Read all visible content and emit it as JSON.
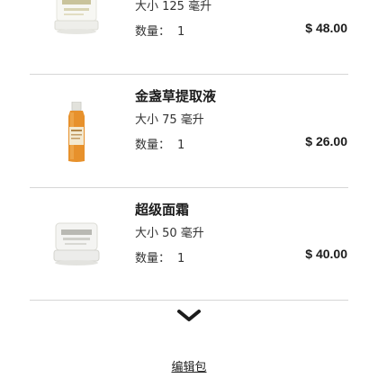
{
  "items": [
    {
      "name": "",
      "size": "大小 125 毫升",
      "qty_label": "数量：",
      "qty": "1",
      "price": "$ 48.00"
    },
    {
      "name": "金盏草提取液",
      "size": "大小 75 毫升",
      "qty_label": "数量：",
      "qty": "1",
      "price": "$ 26.00"
    },
    {
      "name": "超级面霜",
      "size": "大小 50 毫升",
      "qty_label": "数量：",
      "qty": "1",
      "price": "$ 40.00"
    }
  ],
  "icons": {
    "expand": "chevron-down-icon"
  },
  "edit_bag_label": "编辑包"
}
